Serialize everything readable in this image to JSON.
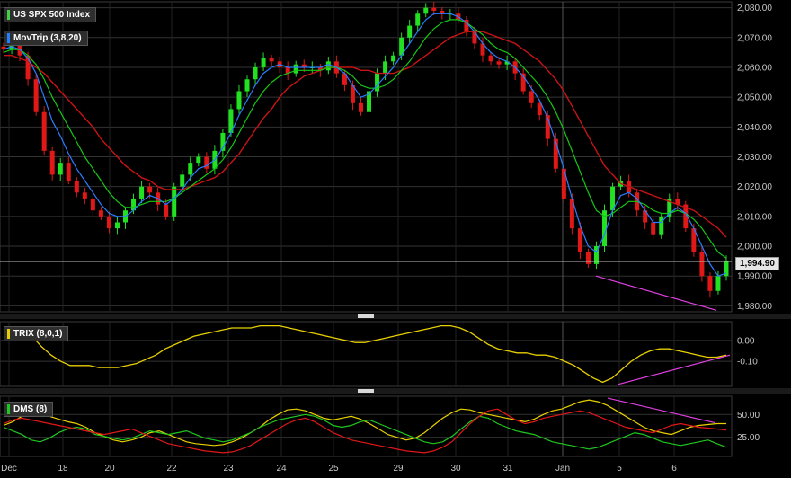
{
  "chart_data": [
    {
      "type": "line",
      "panel": "price",
      "title": "US SPX 500 Index",
      "study": "MovTrip (3,8,20)",
      "last_price": "1,994.90",
      "ylim": [
        1978,
        2082
      ],
      "y_ticks": [
        "2,080.00",
        "2,070.00",
        "2,060.00",
        "2,050.00",
        "2,040.00",
        "2,030.00",
        "2,020.00",
        "2,010.00",
        "2,000.00",
        "1,990.00",
        "1,980.00"
      ],
      "x_ticks": [
        "Dec",
        "18",
        "20",
        "22",
        "23",
        "24",
        "25",
        "29",
        "30",
        "31",
        "Jan",
        "5",
        "6"
      ],
      "close": [
        2066,
        2070,
        2064,
        2056,
        2045,
        2032,
        2024,
        2028,
        2022,
        2018,
        2016,
        2012,
        2010,
        2006,
        2008,
        2012,
        2016,
        2020,
        2018,
        2014,
        2010,
        2020,
        2024,
        2028,
        2030,
        2026,
        2032,
        2038,
        2046,
        2052,
        2056,
        2060,
        2063,
        2062,
        2060,
        2058,
        2061,
        2060,
        2060,
        2059,
        2062,
        2058,
        2054,
        2048,
        2045,
        2052,
        2058,
        2062,
        2064,
        2070,
        2074,
        2078,
        2080,
        2079,
        2078,
        2078,
        2076,
        2072,
        2068,
        2064,
        2062,
        2061,
        2062,
        2058,
        2052,
        2048,
        2044,
        2036,
        2026,
        2016,
        2006,
        1998,
        1994,
        2000,
        2012,
        2020,
        2022,
        2018,
        2012,
        2008,
        2004,
        2010,
        2016,
        2014,
        2006,
        1998,
        1990,
        1985,
        1990,
        1994.9
      ],
      "ma_fast": [
        2066,
        2067,
        2066,
        2063,
        2058,
        2050,
        2042,
        2037,
        2031,
        2026,
        2022,
        2018,
        2014,
        2011,
        2010,
        2010,
        2012,
        2015,
        2017,
        2016,
        2014,
        2016,
        2019,
        2023,
        2026,
        2027,
        2029,
        2033,
        2038,
        2044,
        2049,
        2054,
        2058,
        2060,
        2061,
        2060,
        2060,
        2060,
        2060,
        2060,
        2061,
        2060,
        2058,
        2054,
        2050,
        2051,
        2054,
        2057,
        2060,
        2064,
        2068,
        2072,
        2076,
        2078,
        2078,
        2078,
        2077,
        2075,
        2072,
        2068,
        2065,
        2063,
        2062,
        2060,
        2057,
        2053,
        2049,
        2043,
        2035,
        2026,
        2016,
        2007,
        2000,
        1998,
        2004,
        2012,
        2017,
        2018,
        2016,
        2012,
        2008,
        2008,
        2011,
        2013,
        2011,
        2006,
        2000,
        1994,
        1990,
        1991
      ],
      "ma_mid": [
        2065,
        2066,
        2066,
        2064,
        2061,
        2056,
        2050,
        2045,
        2040,
        2035,
        2030,
        2026,
        2022,
        2018,
        2015,
        2013,
        2013,
        2014,
        2015,
        2015,
        2015,
        2016,
        2018,
        2020,
        2022,
        2024,
        2026,
        2029,
        2033,
        2038,
        2043,
        2048,
        2052,
        2055,
        2057,
        2058,
        2059,
        2059,
        2059,
        2059,
        2060,
        2060,
        2059,
        2057,
        2054,
        2053,
        2053,
        2054,
        2056,
        2059,
        2062,
        2066,
        2070,
        2073,
        2075,
        2076,
        2076,
        2075,
        2073,
        2071,
        2068,
        2066,
        2065,
        2063,
        2060,
        2057,
        2054,
        2050,
        2045,
        2039,
        2032,
        2025,
        2018,
        2012,
        2010,
        2011,
        2013,
        2015,
        2015,
        2014,
        2012,
        2011,
        2011,
        2012,
        2011,
        2009,
        2006,
        2002,
        1998,
        1996
      ],
      "ma_slow": [
        2064,
        2064,
        2063,
        2062,
        2060,
        2058,
        2055,
        2052,
        2049,
        2046,
        2043,
        2040,
        2036,
        2033,
        2030,
        2027,
        2025,
        2023,
        2022,
        2020,
        2019,
        2019,
        2019,
        2020,
        2021,
        2022,
        2023,
        2025,
        2028,
        2031,
        2035,
        2039,
        2043,
        2046,
        2050,
        2053,
        2055,
        2057,
        2058,
        2059,
        2060,
        2060,
        2060,
        2060,
        2059,
        2059,
        2058,
        2058,
        2058,
        2059,
        2060,
        2062,
        2064,
        2066,
        2068,
        2070,
        2071,
        2072,
        2072,
        2072,
        2071,
        2070,
        2069,
        2068,
        2066,
        2064,
        2062,
        2059,
        2056,
        2052,
        2047,
        2042,
        2037,
        2032,
        2027,
        2024,
        2021,
        2020,
        2019,
        2018,
        2017,
        2016,
        2015,
        2014,
        2013,
        2012,
        2010,
        2008,
        2006,
        2003
      ]
    },
    {
      "type": "line",
      "panel": "trix",
      "study": "TRIX (8,0,1)",
      "ylim": [
        -0.22,
        0.09
      ],
      "y_ticks": [
        "0.00",
        "-0.10"
      ],
      "trix": [
        0.05,
        0.06,
        0.05,
        0.02,
        -0.03,
        -0.07,
        -0.1,
        -0.12,
        -0.12,
        -0.12,
        -0.13,
        -0.13,
        -0.13,
        -0.12,
        -0.11,
        -0.09,
        -0.07,
        -0.04,
        -0.02,
        0.0,
        0.02,
        0.03,
        0.04,
        0.05,
        0.06,
        0.06,
        0.06,
        0.07,
        0.07,
        0.07,
        0.06,
        0.05,
        0.04,
        0.03,
        0.02,
        0.01,
        0.0,
        -0.01,
        -0.01,
        0.0,
        0.01,
        0.02,
        0.03,
        0.04,
        0.05,
        0.06,
        0.07,
        0.07,
        0.06,
        0.04,
        0.01,
        -0.02,
        -0.04,
        -0.05,
        -0.06,
        -0.06,
        -0.07,
        -0.07,
        -0.08,
        -0.1,
        -0.12,
        -0.15,
        -0.18,
        -0.2,
        -0.18,
        -0.14,
        -0.1,
        -0.07,
        -0.05,
        -0.04,
        -0.04,
        -0.05,
        -0.06,
        -0.07,
        -0.08,
        -0.08,
        -0.07
      ]
    },
    {
      "type": "line",
      "panel": "dms",
      "study": "DMS (8)",
      "ylim": [
        4,
        70
      ],
      "y_ticks": [
        "50.00",
        "25.00"
      ],
      "series": [
        {
          "values": [
            38,
            42,
            48,
            52,
            50,
            48,
            45,
            42,
            40,
            36,
            30,
            26,
            22,
            20,
            22,
            25,
            30,
            32,
            28,
            24,
            20,
            18,
            17,
            16,
            17,
            20,
            24,
            30,
            36,
            44,
            50,
            55,
            56,
            54,
            50,
            46,
            44,
            46,
            48,
            45,
            40,
            34,
            28,
            25,
            22,
            24,
            30,
            38,
            46,
            52,
            56,
            55,
            52,
            50,
            48,
            46,
            44,
            42,
            45,
            50,
            54,
            56,
            60,
            64,
            66,
            64,
            60,
            54,
            48,
            42,
            36,
            32,
            30,
            28,
            32,
            36,
            38,
            39,
            40,
            40
          ]
        },
        {
          "values": [
            36,
            32,
            28,
            22,
            20,
            24,
            30,
            34,
            36,
            34,
            28,
            26,
            24,
            22,
            24,
            28,
            32,
            30,
            28,
            30,
            32,
            28,
            24,
            22,
            20,
            22,
            26,
            30,
            36,
            40,
            44,
            46,
            48,
            50,
            48,
            44,
            38,
            36,
            38,
            42,
            44,
            40,
            36,
            32,
            28,
            24,
            20,
            18,
            20,
            26,
            34,
            42,
            48,
            46,
            40,
            36,
            32,
            30,
            28,
            24,
            20,
            18,
            16,
            14,
            12,
            14,
            18,
            22,
            26,
            30,
            28,
            24,
            20,
            18,
            16,
            18,
            20,
            22,
            18,
            14
          ]
        },
        {
          "values": [
            40,
            44,
            46,
            44,
            42,
            40,
            38,
            36,
            34,
            32,
            30,
            28,
            30,
            32,
            34,
            30,
            26,
            22,
            18,
            16,
            14,
            12,
            10,
            9,
            8,
            9,
            12,
            16,
            22,
            28,
            34,
            40,
            44,
            46,
            42,
            36,
            30,
            26,
            22,
            20,
            18,
            16,
            14,
            12,
            10,
            9,
            8,
            10,
            14,
            20,
            30,
            40,
            48,
            54,
            56,
            50,
            44,
            40,
            42,
            46,
            48,
            50,
            52,
            54,
            52,
            48,
            44,
            40,
            36,
            34,
            32,
            30,
            34,
            38,
            40,
            38,
            36,
            35,
            34,
            33
          ]
        }
      ]
    }
  ]
}
